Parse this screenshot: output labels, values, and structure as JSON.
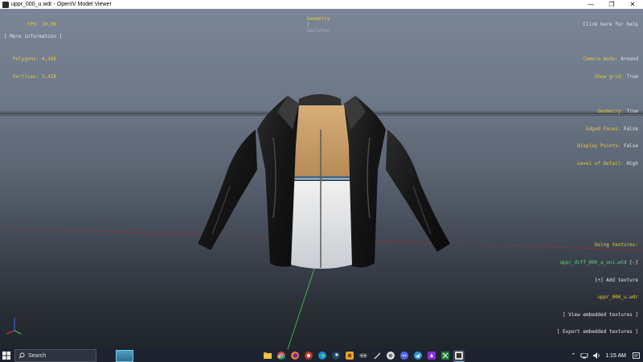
{
  "window": {
    "title": "uppr_000_u.wdr - OpenIV Model Viewer"
  },
  "hud_top_left": {
    "fps_label": "FPS:",
    "fps_value": "19.06",
    "polygons_label": "Polygons:",
    "polygons_value": "4,368",
    "vertices_label": "Vertices:",
    "vertices_value": "3,428",
    "more_info": "[ More information ]"
  },
  "hud_top_center": {
    "geometry": "Geometry",
    "separator": "|",
    "skeleton": "Skeleton"
  },
  "hud_top_right": {
    "help": "Click here for help",
    "camera_mode_label": "Camera mode:",
    "camera_mode_value": "Around",
    "show_grid_label": "Show grid:",
    "show_grid_value": "True",
    "geometry_label": "Geometry:",
    "geometry_value": "True",
    "edged_faces_label": "Edged Faces:",
    "edged_faces_value": "False",
    "display_points_label": "Display Points:",
    "display_points_value": "False",
    "lod_label": "Level of Detail:",
    "lod_value": "High"
  },
  "hud_bottom_right": {
    "using_textures": "Using textures:",
    "texture_file": "uppr_diff_000_a_uni.wtd",
    "texture_toggle": "[-]",
    "add_texture": "[+] Add texture",
    "model_file": "uppr_000_u.wdr",
    "view_embedded": "[ View embedded textures ]",
    "export_embedded": "[ Export embedded textures ]"
  },
  "taskbar": {
    "search_placeholder": "Search",
    "time": "1:15 AM"
  },
  "colors": {
    "hud_yellow": "#e8c93e",
    "hud_green": "#5fd27b",
    "taskbar": "#1d2430"
  }
}
